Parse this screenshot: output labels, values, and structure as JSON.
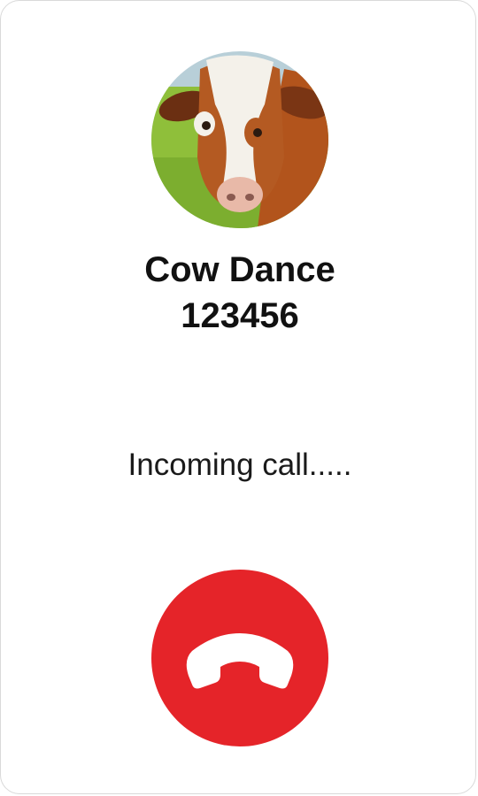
{
  "caller": {
    "name": "Cow Dance",
    "number": "123456",
    "avatar_icon": "cow-photo"
  },
  "call": {
    "status": "Incoming call.....",
    "end_button_icon": "phone-hangup-icon"
  },
  "colors": {
    "background": "#ffffff",
    "end_call": "#e52429",
    "text": "#111111"
  }
}
